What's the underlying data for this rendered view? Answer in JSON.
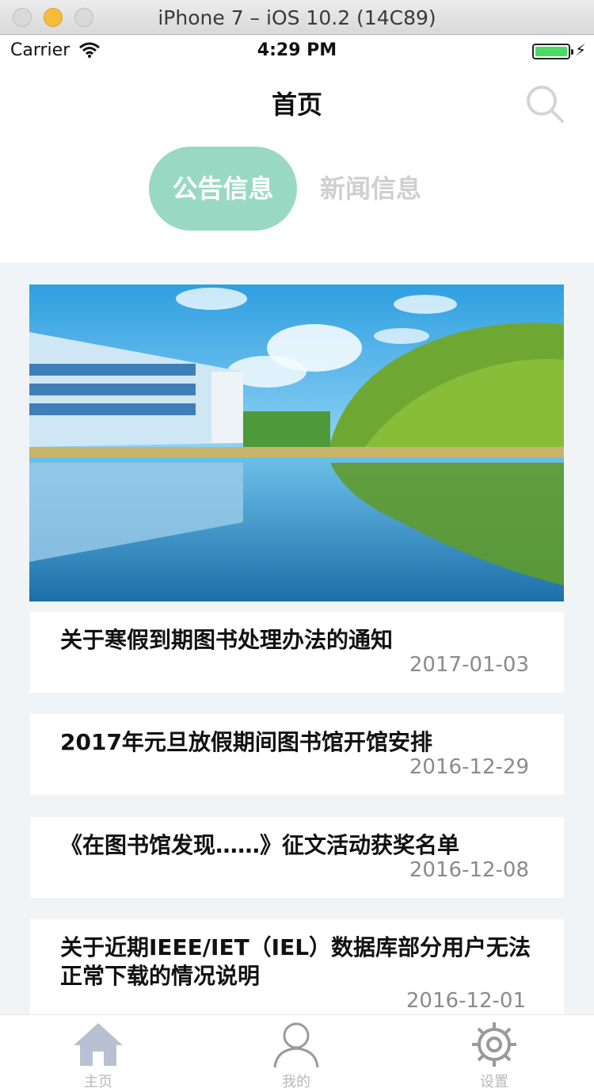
{
  "simulator": {
    "title": "iPhone 7 – iOS 10.2 (14C89)"
  },
  "status_bar": {
    "carrier": "Carrier",
    "time": "4:29 PM"
  },
  "nav": {
    "title": "首页"
  },
  "tabs": {
    "active": "公告信息",
    "inactive": "新闻信息"
  },
  "news": [
    {
      "title": "关于寒假到期图书处理办法的通知",
      "date": "2017-01-03"
    },
    {
      "title": "2017年元旦放假期间图书馆开馆安排",
      "date": "2016-12-29"
    },
    {
      "title": "《在图书馆发现……》征文活动获奖名单",
      "date": "2016-12-08"
    },
    {
      "title": "关于近期IEEE/IET（IEL）数据库部分用户无法正常下载的情况说明",
      "date": "2016-12-01"
    }
  ],
  "tab_bar": {
    "home": "主页",
    "mine": "我的",
    "settings": "设置"
  },
  "colors": {
    "accent": "#99d9c4",
    "background": "#f1f4f7"
  }
}
